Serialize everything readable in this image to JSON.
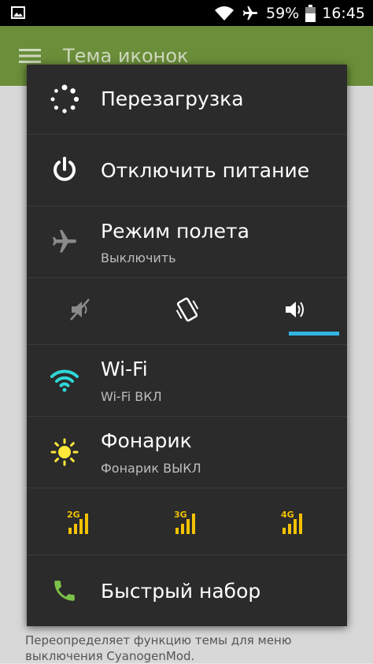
{
  "status_bar": {
    "battery": "59%",
    "time": "16:45",
    "icons": [
      "image-icon",
      "wifi-icon",
      "airplane-icon",
      "battery-icon"
    ]
  },
  "background_app": {
    "title": "Тема иконок",
    "description": "Переопределяет функцию темы для меню выключения CyanogenMod."
  },
  "power_menu": {
    "reboot": {
      "label": "Перезагрузка"
    },
    "power_off": {
      "label": "Отключить питание"
    },
    "airplane": {
      "label": "Режим полета",
      "sub": "Выключить"
    },
    "sound_modes": {
      "selected": "sound"
    },
    "wifi": {
      "label": "Wi-Fi",
      "sub": "Wi-Fi ВКЛ"
    },
    "flashlight": {
      "label": "Фонарик",
      "sub": "Фонарик ВЫКЛ"
    },
    "network_modes": [
      {
        "label": "2G"
      },
      {
        "label": "3G"
      },
      {
        "label": "4G"
      }
    ],
    "speed_dial": {
      "label": "Быстрый набор"
    }
  },
  "colors": {
    "accent": "#33b5e5",
    "appbar": "#6b8e3a",
    "dialog_bg": "#2b2b2b",
    "network": "#f2c200",
    "wifi": "#2fd6d6",
    "flash": "#ffe83a",
    "phone": "#7cc24a"
  }
}
